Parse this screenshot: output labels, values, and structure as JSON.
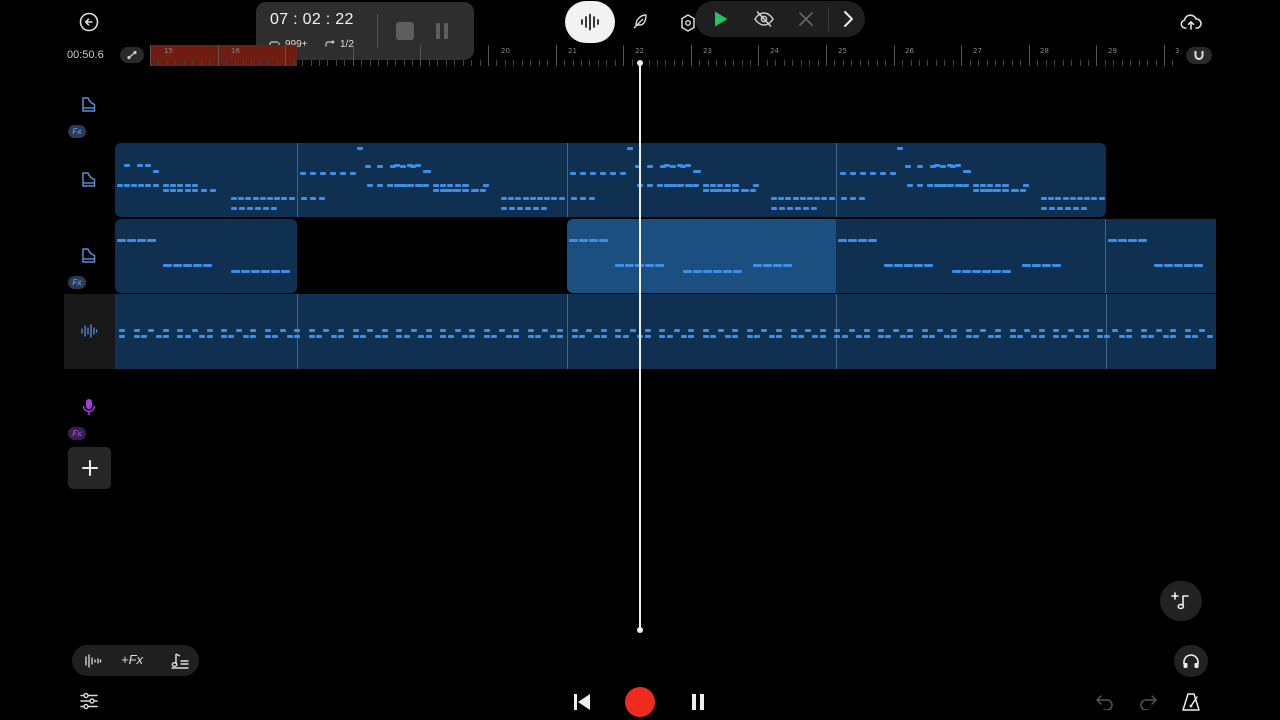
{
  "topbar": {
    "time_position": "00:50.6",
    "timer": "07 : 02 : 22",
    "loop_count": "999+",
    "loop_fraction": "1/2"
  },
  "ruler": {
    "bar_numbers": [
      "15",
      "16",
      "20",
      "21",
      "22",
      "23",
      "24",
      "25",
      "26",
      "27",
      "28",
      "29",
      "3"
    ]
  },
  "bottom_tools": {
    "fx_label": "+Fx"
  },
  "colors": {
    "background": "#000000",
    "clip": "#0f3050",
    "clip_selected": "#1a4f80",
    "note": "#3d8ee8",
    "instrument_icon": "#5b8dd9",
    "mic_icon": "#a23ee0",
    "record": "#ee2b1d",
    "play_green": "#22c55e",
    "loop_region": "#6e1d10"
  },
  "icons": {
    "back": "arrow-left-circle-icon",
    "cloud": "cloud-upload-icon",
    "waveform_mode": "waveform-icon",
    "pen_mode": "feather-pen-icon",
    "play": "play-icon",
    "hide": "eye-off-icon",
    "close": "close-icon",
    "next": "chevron-right-icon",
    "magnet": "magnet-icon"
  }
}
